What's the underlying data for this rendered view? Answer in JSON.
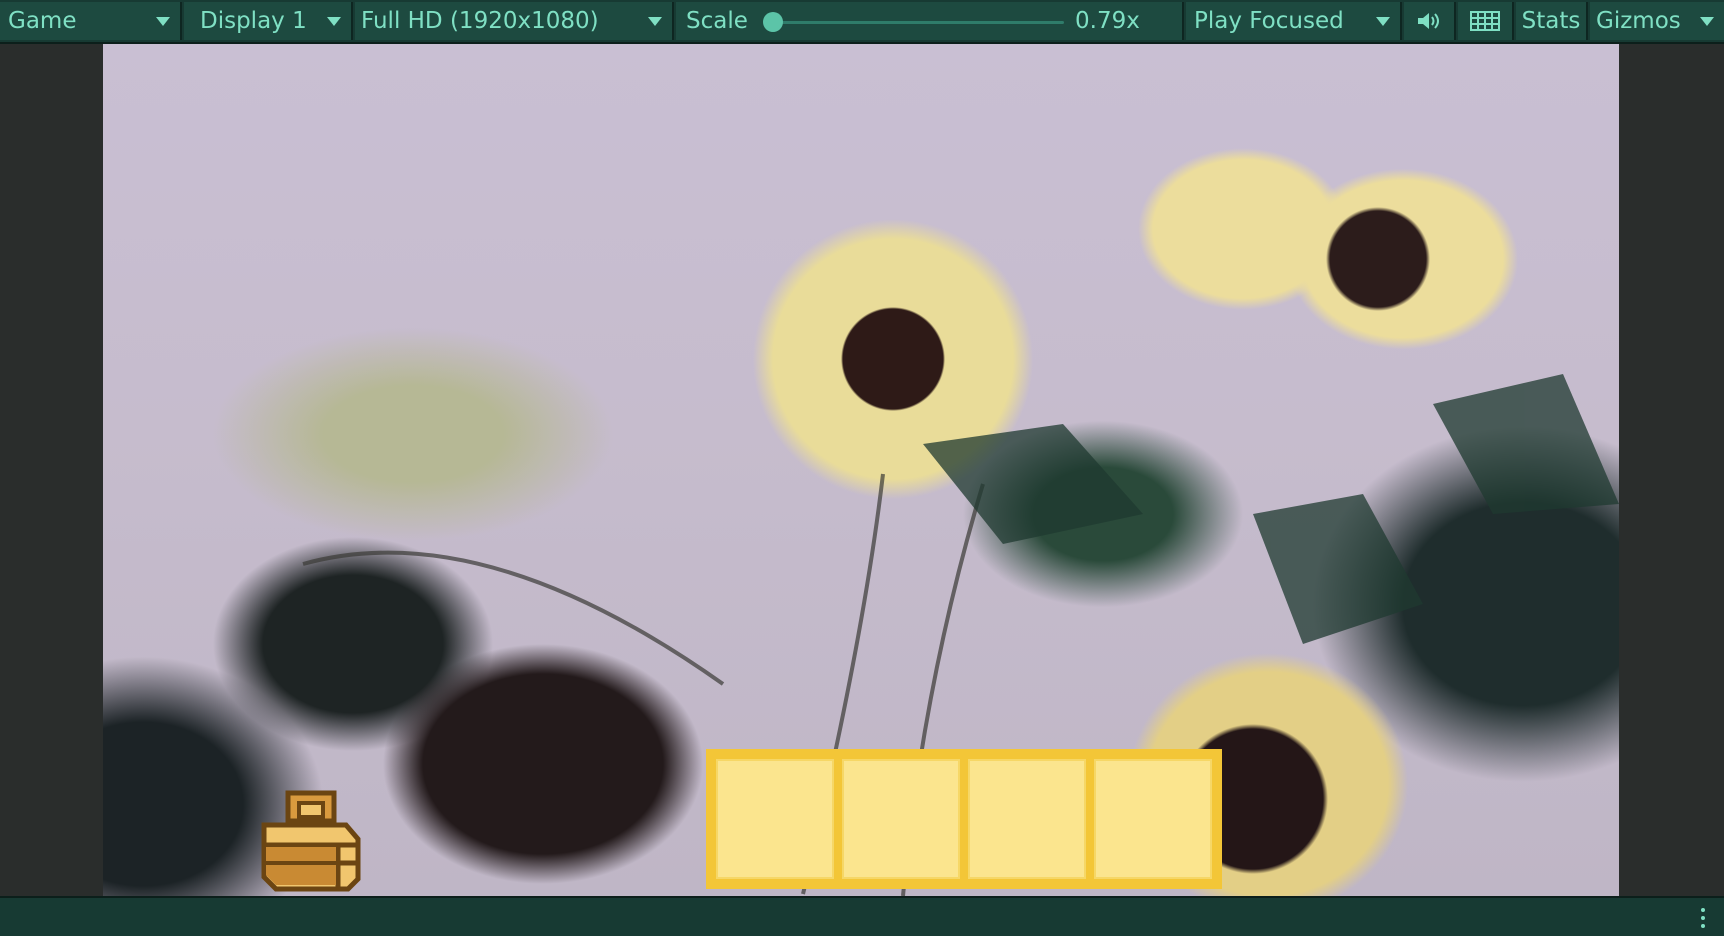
{
  "toolbar": {
    "view_label": "Game",
    "display_label": "Display 1",
    "resolution_label": "Full HD (1920x1080)",
    "scale_label": "Scale",
    "scale_value": "0.79x",
    "scale_level": 0.0,
    "play_mode_label": "Play Focused",
    "stats_label": "Stats",
    "gizmos_label": "Gizmos",
    "audio_icon": "speaker-icon",
    "keyboard_icon": "keyboard-icon"
  },
  "viewport": {
    "inventory": {
      "slot_count": 4,
      "slots": [
        "",
        "",
        "",
        ""
      ]
    },
    "bag_icon": "bag-icon"
  },
  "statusbar": {
    "more_icon": "kebab-menu-icon"
  },
  "colors": {
    "toolbar_bg": "#173a33",
    "toolbar_text": "#7fe0c4",
    "inventory_border": "#f3c637",
    "inventory_slot": "#fbe58e",
    "bag": "#c98f3a"
  }
}
